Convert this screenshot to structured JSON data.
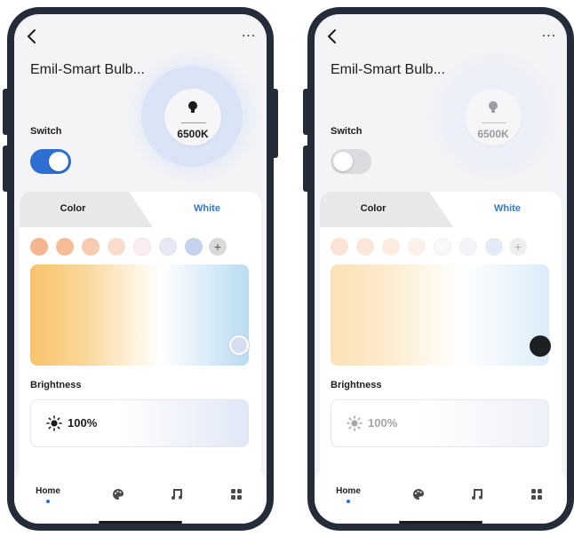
{
  "screens": [
    {
      "state": "on",
      "back_icon": "chevron-left-icon",
      "more_label": "...",
      "title": "Emil-Smart Bulb...",
      "switch_label": "Switch",
      "switch_on": true,
      "bulb_icon": "bulb-icon",
      "kelvin": "6500K",
      "tabs": [
        "Color",
        "White"
      ],
      "active_tab": "White",
      "swatch_colors": [
        "#f4b68f",
        "#f6bd98",
        "#f8cbb0",
        "#f9dccb",
        "#fbeef0",
        "#e6e9f4",
        "#c4d2ee"
      ],
      "plus_label": "+",
      "picker_knob_color": "#d7def0",
      "brightness_label": "Brightness",
      "brightness_value": "100%",
      "sun_icon": "sun-icon",
      "nav": {
        "home_label": "Home",
        "icons": [
          "palette-icon",
          "music-icon",
          "grid-icon"
        ]
      },
      "colors": {
        "toggle_track": "#2f6fd4",
        "text": "#1d1d1f",
        "icon": "#4a4a4a"
      }
    },
    {
      "state": "off",
      "back_icon": "chevron-left-icon",
      "more_label": "...",
      "title": "Emil-Smart Bulb...",
      "switch_label": "Switch",
      "switch_on": false,
      "bulb_icon": "bulb-icon",
      "kelvin": "6500K",
      "tabs": [
        "Color",
        "White"
      ],
      "active_tab": "White",
      "swatch_colors": [
        "#fbe4d5",
        "#fbe7da",
        "#fbecdf",
        "#fcf1ea",
        "#fbf8f9",
        "#f3f4f8",
        "#e5ebf6"
      ],
      "plus_label": "+",
      "picker_knob_color": "#1e1f23",
      "brightness_label": "Brightness",
      "brightness_value": "100%",
      "sun_icon": "sun-icon",
      "nav": {
        "home_label": "Home",
        "icons": [
          "palette-icon",
          "music-icon",
          "grid-icon"
        ]
      },
      "colors": {
        "toggle_track": "#dcdce0",
        "text": "#9a9aa0",
        "icon": "#9a9aa0"
      }
    }
  ]
}
